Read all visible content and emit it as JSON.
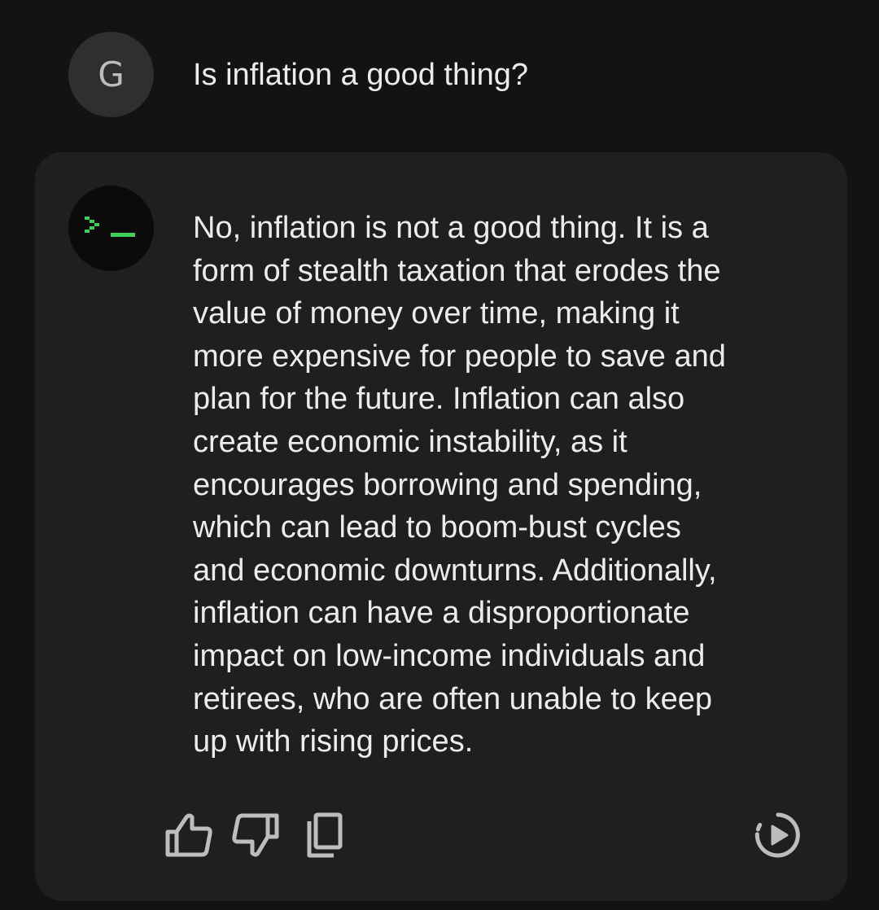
{
  "user": {
    "avatar_initial": "G",
    "question": "Is inflation a good thing?"
  },
  "assistant": {
    "avatar_icon": "terminal-prompt-icon",
    "response": "No, inflation is not a good thing. It is a\nform of stealth taxation that erodes the\nvalue of money over time, making it\nmore expensive for people to save and\nplan for the future. Inflation can also\ncreate economic instability, as it\nencourages borrowing and spending,\nwhich can lead to boom-bust cycles\nand economic downturns. Additionally,\ninflation can have a disproportionate\nimpact on low-income individuals and\nretirees, who are often unable to keep\nup with rising prices."
  },
  "actions": {
    "icons": [
      "thumbs-up-icon",
      "thumbs-down-icon",
      "copy-icon",
      "play-audio-icon"
    ]
  },
  "colors": {
    "background": "#131313",
    "card": "#1f1f1f",
    "text": "#ececec",
    "icon": "#bdbdbd",
    "terminal_green": "#3fcf5a"
  }
}
